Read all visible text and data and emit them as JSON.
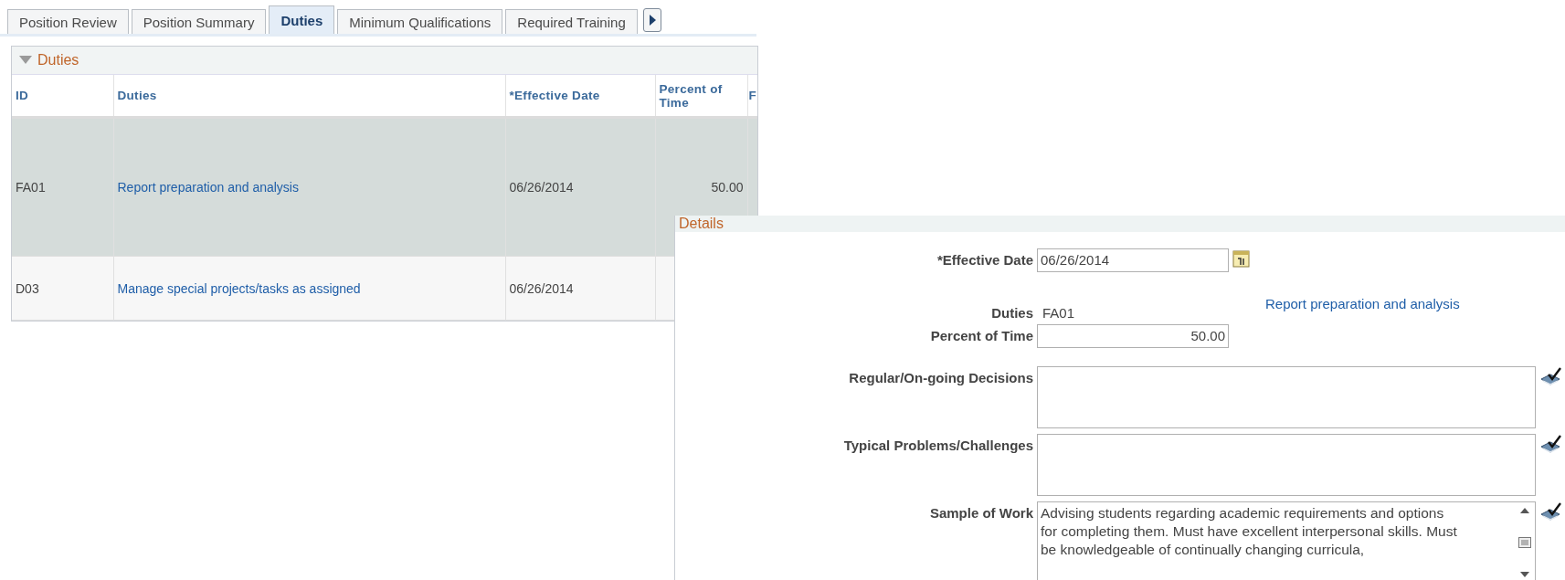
{
  "tabs": [
    {
      "label": "Position Review",
      "selected": false
    },
    {
      "label": "Position Summary",
      "selected": false
    },
    {
      "label": "Duties",
      "selected": true
    },
    {
      "label": "Minimum Qualifications",
      "selected": false
    },
    {
      "label": "Required Training",
      "selected": false
    }
  ],
  "duties_grid": {
    "title": "Duties",
    "expanded": true,
    "columns": [
      "ID",
      "Duties",
      "*Effective Date",
      "Percent of Time",
      "F"
    ],
    "rows": [
      {
        "id": "FA01",
        "duty": "Report preparation and analysis",
        "effective_date": "06/26/2014",
        "percent": "50.00",
        "selected": true
      },
      {
        "id": "D03",
        "duty": "Manage special projects/tasks as assigned",
        "effective_date": "06/26/2014",
        "selected": false
      }
    ]
  },
  "details": {
    "title": "Details",
    "fields": [
      {
        "kind": "date",
        "label": "*Effective Date",
        "value": "06/26/2014"
      },
      {
        "kind": "display",
        "label": "Duties",
        "value": "FA01",
        "link": "Report preparation and analysis"
      },
      {
        "kind": "number",
        "label": "Percent of Time",
        "value": "50.00"
      },
      {
        "kind": "textarea",
        "label": "Regular/On-going Decisions"
      },
      {
        "kind": "textarea",
        "label": "Typical Problems/Challenges"
      },
      {
        "kind": "textarea",
        "label": "Sample of Work",
        "value": "Advising students regarding academic requirements and options for completing them. Must have excellent interpersonal skills. Must be knowledgeable of continually changing curricula,",
        "scrollable": true
      }
    ]
  }
}
